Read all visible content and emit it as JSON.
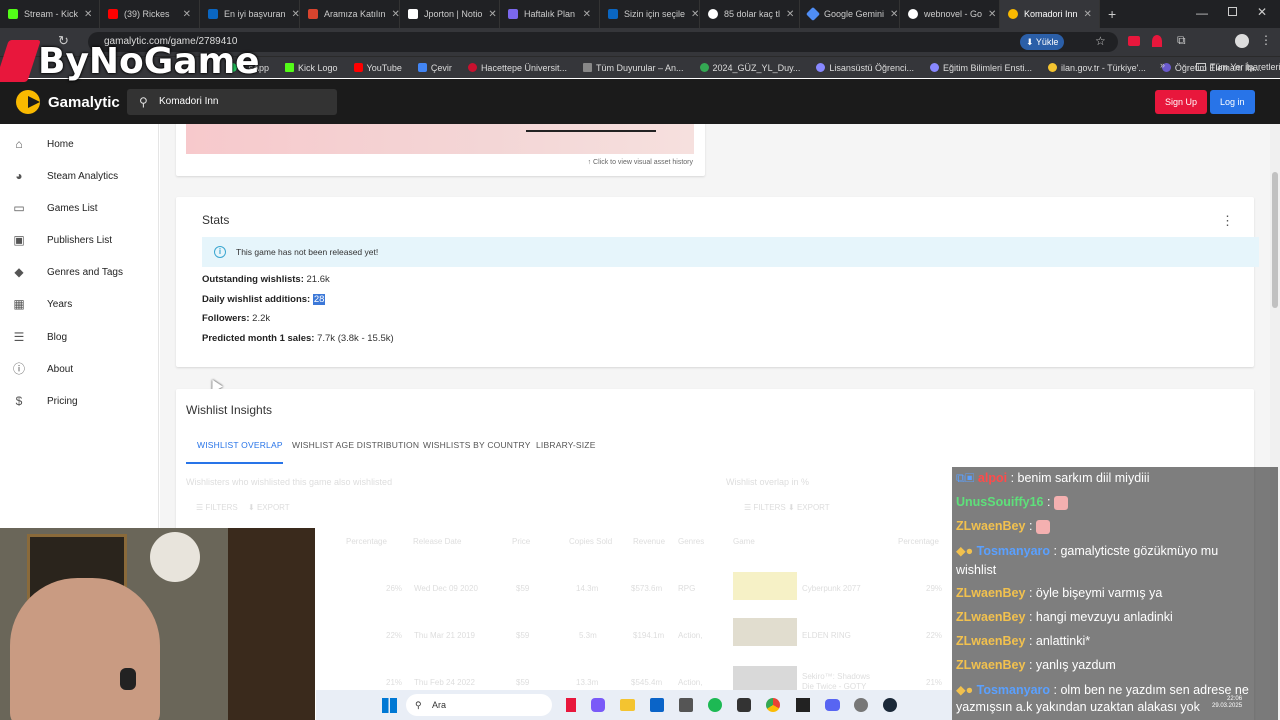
{
  "browser": {
    "tabs": [
      {
        "label": "Stream - Kick",
        "color": "#53fc18"
      },
      {
        "label": "(39) Rickes",
        "color": "#ff0000"
      },
      {
        "label": "En iyi başvuran",
        "color": "#0a66c2"
      },
      {
        "label": "Aramıza Katılın",
        "color": "#d9442e"
      },
      {
        "label": "Jporton | Notio",
        "color": "#ffffff"
      },
      {
        "label": "Haftalık Plan",
        "color": "#7b68ee"
      },
      {
        "label": "Sizin için seçile",
        "color": "#0a66c2"
      },
      {
        "label": "85 dolar kaç tl",
        "color": "#ffffff"
      },
      {
        "label": "Google Gemini",
        "color": "#4f8df5"
      },
      {
        "label": "webnovel - Go",
        "color": "#ffffff"
      },
      {
        "label": "Komadori Inn",
        "color": "#f9b900",
        "active": true
      }
    ],
    "url": "gamalytic.com/game/2789410",
    "translate_label": "Yükle",
    "bookmarks": [
      {
        "label": "...sApp",
        "color": "#25d366"
      },
      {
        "label": "Kick Logo",
        "color": "#53fc18"
      },
      {
        "label": "YouTube",
        "color": "#ff0000"
      },
      {
        "label": "Çevir",
        "color": "#4285f4"
      },
      {
        "label": "Hacettepe Üniversit...",
        "color": "#c8102e"
      },
      {
        "label": "Tüm Duyurular – An...",
        "color": "#888888"
      },
      {
        "label": "2024_GÜZ_YL_Duy...",
        "color": "#34a853"
      },
      {
        "label": "Lisansüstü Öğrenci...",
        "color": "#8888ff"
      },
      {
        "label": "Eğitim Bilimleri Ensti...",
        "color": "#8888ff"
      },
      {
        "label": "ilan.gov.tr - Türkiye'...",
        "color": "#f4c430"
      },
      {
        "label": "Öğretim Elemanı İla...",
        "color": "#6a5acd"
      }
    ],
    "all_bookmarks": "Tüm Yer İşaretleri"
  },
  "watermark": "ByNoGame",
  "site": {
    "brand": "Gamalytic",
    "search_value": "Komadori Inn",
    "signup_label": "Sign Up",
    "login_label": "Log in",
    "signup_color": "#e8173c",
    "login_color": "#2874e8"
  },
  "sidebar": {
    "items": [
      {
        "label": "Home",
        "icon": "home-icon"
      },
      {
        "label": "Steam Analytics",
        "icon": "pie-chart-icon"
      },
      {
        "label": "Games List",
        "icon": "gamepad-icon"
      },
      {
        "label": "Publishers List",
        "icon": "briefcase-icon"
      },
      {
        "label": "Genres and Tags",
        "icon": "tag-icon"
      },
      {
        "label": "Years",
        "icon": "calendar-icon"
      },
      {
        "label": "Blog",
        "icon": "article-icon"
      },
      {
        "label": "About",
        "icon": "info-icon"
      },
      {
        "label": "Pricing",
        "icon": "dollar-icon"
      }
    ]
  },
  "main": {
    "visual_history_link": "↑ Click to view visual asset history",
    "stats": {
      "title": "Stats",
      "notice": "This game has not been released yet!",
      "outstanding_label": "Outstanding wishlists:",
      "outstanding_value": "21.6k",
      "daily_label": "Daily wishlist additions:",
      "daily_value": "28",
      "followers_label": "Followers:",
      "followers_value": "2.2k",
      "predicted_label": "Predicted month 1 sales:",
      "predicted_value": "7.7k (3.8k - 15.5k)"
    },
    "insights": {
      "title": "Wishlist Insights",
      "tabs": [
        "WISHLIST OVERLAP",
        "WISHLIST AGE DISTRIBUTION",
        "WISHLISTS BY COUNTRY",
        "LIBRARY-SIZE"
      ],
      "left_caption": "Wishlisters who wishlisted this game also wishlisted",
      "right_caption": "Wishlist overlap in %",
      "filters": "FILTERS",
      "export": "EXPORT",
      "left_columns": [
        "Percentage",
        "Release Date",
        "Price",
        "Copies Sold",
        "Revenue",
        "Genres"
      ],
      "left_rows": [
        [
          "26%",
          "Wed Dec 09 2020",
          "$59",
          "14.3m",
          "$573.6m",
          "RPG"
        ],
        [
          "22%",
          "Thu Mar 21 2019",
          "$59",
          "5.3m",
          "$194.1m",
          "Action,"
        ],
        [
          "21%",
          "Thu Feb 24 2022",
          "$59",
          "13.3m",
          "$545.4m",
          "Action,"
        ]
      ],
      "right_columns": [
        "Game",
        "Percentage"
      ],
      "right_rows": [
        [
          "Cyberpunk 2077",
          "29%"
        ],
        [
          "ELDEN RING",
          "22%"
        ],
        [
          "Sekiro™: Shadows Die Twice - GOTY",
          "21%"
        ]
      ]
    }
  },
  "chat": [
    {
      "user": "alpoi",
      "user_color": "#ff4a4a",
      "text": "benim sarkım diil miydiii"
    },
    {
      "user": "UnusSouiffy16",
      "user_color": "#5ee07a",
      "text": ":"
    },
    {
      "user": "ZLwaenBey",
      "user_color": "#f2c14e",
      "text": ":"
    },
    {
      "user": "Tosmanyaro",
      "user_color": "#5aa0ff",
      "text": "gamalyticste gözükmüyo mu"
    },
    {
      "user": "",
      "user_color": "#ffffff",
      "text": "wishlist"
    },
    {
      "user": "ZLwaenBey",
      "user_color": "#f2c14e",
      "text": "öyle bişeymi varmış ya"
    },
    {
      "user": "ZLwaenBey",
      "user_color": "#f2c14e",
      "text": "hangi mevzuyu anladinki"
    },
    {
      "user": "ZLwaenBey",
      "user_color": "#f2c14e",
      "text": "anlattinki*"
    },
    {
      "user": "ZLwaenBey",
      "user_color": "#f2c14e",
      "text": "yanlış yazdum"
    },
    {
      "user": "Tosmanyaro",
      "user_color": "#5aa0ff",
      "text": "olm ben ne yazdım sen adrese ne"
    },
    {
      "user": "",
      "user_color": "#ffffff",
      "text": "yazmışsın a.k yakından uzaktan alakası yok"
    }
  ],
  "taskbar": {
    "search_placeholder": "Ara",
    "time": "22:06",
    "date": "29.03.2025"
  }
}
